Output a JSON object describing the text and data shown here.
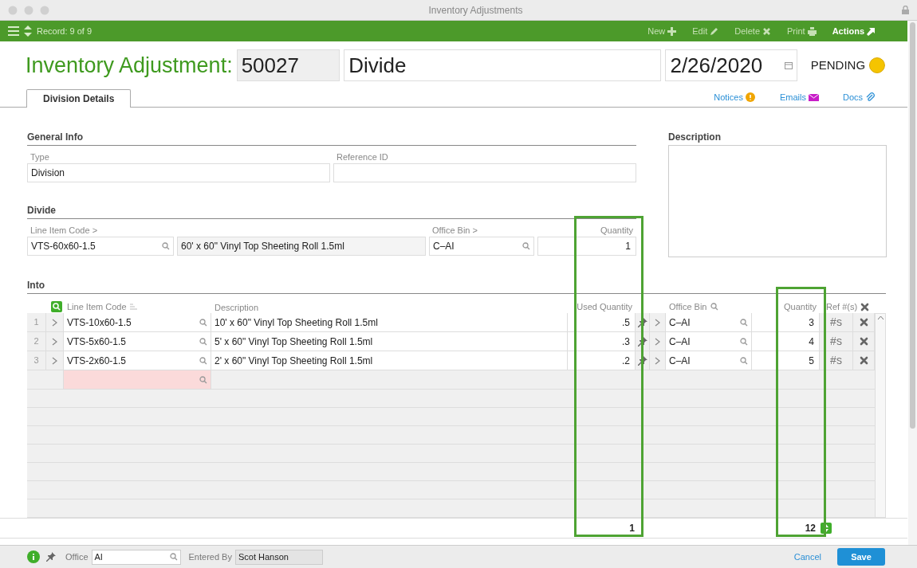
{
  "window": {
    "title": "Inventory Adjustments"
  },
  "toolbar": {
    "record": "Record: 9 of 9",
    "actions": [
      {
        "label": "New",
        "kind": "new",
        "disabled": true
      },
      {
        "label": "Edit",
        "kind": "edit",
        "disabled": true
      },
      {
        "label": "Delete",
        "kind": "delete",
        "disabled": true
      },
      {
        "label": "Print",
        "kind": "print",
        "disabled": true
      },
      {
        "label": "Actions",
        "kind": "actions",
        "disabled": false
      }
    ]
  },
  "header": {
    "title": "Inventory Adjustment:",
    "number": "50027",
    "name": "Divide",
    "date": "2/26/2020",
    "status": "PENDING"
  },
  "tabs": [
    {
      "label": "Division Details",
      "selected": true
    }
  ],
  "links": [
    {
      "label": "Notices",
      "kind": "notices"
    },
    {
      "label": "Emails",
      "kind": "emails"
    },
    {
      "label": "Docs",
      "kind": "docs"
    }
  ],
  "general_info": {
    "heading": "General Info",
    "type_label": "Type",
    "type": "Division",
    "reference_label": "Reference ID"
  },
  "description": {
    "heading": "Description"
  },
  "divide": {
    "heading": "Divide",
    "code_label": "Line Item Code >",
    "code": "VTS-60x60-1.5",
    "description": "60' x 60\" Vinyl Top Sheeting Roll 1.5ml",
    "bin_label": "Office Bin >",
    "bin": "C–AI",
    "quantity_label": "Quantity",
    "quantity": "1"
  },
  "into": {
    "heading": "Into",
    "columns": [
      "Line Item Code",
      "Description",
      "Used Quantity",
      "Office Bin",
      "Quantity",
      "Ref #(s)"
    ],
    "rows": [
      {
        "number": "1",
        "code": "VTS-10x60-1.5",
        "description": "10' x 60\" Vinyl Top Sheeting Roll 1.5ml",
        "used_quantity": ".5",
        "office_bin": "C–AI",
        "quantity": "3",
        "ref": "#s"
      },
      {
        "number": "2",
        "code": "VTS-5x60-1.5",
        "description": "5' x 60\" Vinyl Top Sheeting Roll 1.5ml",
        "used_quantity": ".3",
        "office_bin": "C–AI",
        "quantity": "4",
        "ref": "#s"
      },
      {
        "number": "3",
        "code": "VTS-2x60-1.5",
        "description": "2' x 60\" Vinyl Top Sheeting Roll 1.5ml",
        "used_quantity": ".2",
        "office_bin": "C–AI",
        "quantity": "5",
        "ref": "#s"
      }
    ],
    "totals": {
      "used_quantity": "1",
      "quantity": "12"
    }
  },
  "footer": {
    "office_label": "Office",
    "office": "AI",
    "entered_by_label": "Entered By",
    "entered_by": "Scot Hanson",
    "cancel": "Cancel",
    "save": "Save"
  }
}
